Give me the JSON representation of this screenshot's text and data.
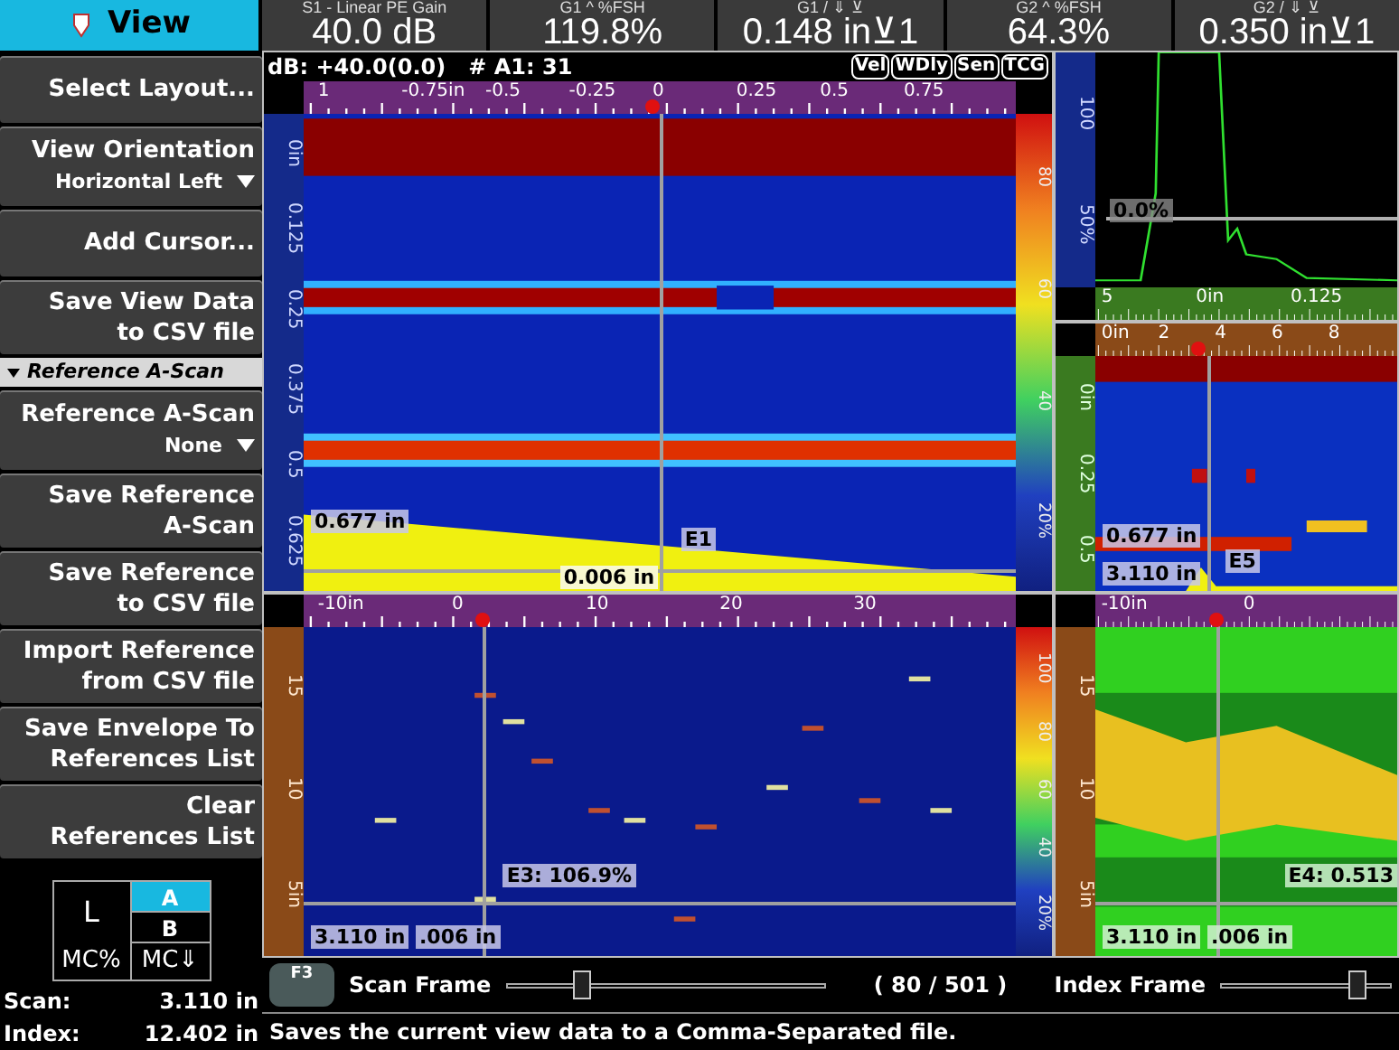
{
  "top_bar": {
    "view_tab": {
      "label": "View",
      "selected": true
    },
    "readouts": [
      {
        "label": "S1 - Linear PE Gain",
        "value": "40.0 dB"
      },
      {
        "label": "G1 ^ %FSH",
        "value": "119.8%"
      },
      {
        "label": "G1 / ⇓ ⊻",
        "value": "0.148 in⊻1"
      },
      {
        "label": "G2 ^ %FSH",
        "value": "64.3%"
      },
      {
        "label": "G2 / ⇓ ⊻",
        "value": "0.350 in⊻1"
      }
    ]
  },
  "sidebar": {
    "items": [
      {
        "kind": "button",
        "lines": [
          "Select Layout..."
        ]
      },
      {
        "kind": "dropdown",
        "lines": [
          "View Orientation"
        ],
        "value": "Horizontal Left"
      },
      {
        "kind": "button",
        "lines": [
          "Add Cursor..."
        ]
      },
      {
        "kind": "button",
        "lines": [
          "Save View Data",
          "to CSV file"
        ]
      },
      {
        "kind": "section",
        "lines": [
          "Reference A-Scan"
        ],
        "expanded": true
      },
      {
        "kind": "dropdown",
        "lines": [
          "Reference A-Scan"
        ],
        "value": "None"
      },
      {
        "kind": "button",
        "lines": [
          "Save Reference",
          "A-Scan"
        ]
      },
      {
        "kind": "button",
        "lines": [
          "Save Reference",
          "to CSV file"
        ]
      },
      {
        "kind": "button",
        "lines": [
          "Import Reference",
          "from CSV file"
        ]
      },
      {
        "kind": "button",
        "lines": [
          "Save Envelope To",
          "References List"
        ]
      },
      {
        "kind": "button",
        "lines": [
          "Clear",
          "References List"
        ]
      }
    ],
    "group_selector": {
      "left_label": "L",
      "tabs": [
        {
          "label": "A",
          "selected": true
        },
        {
          "label": "B",
          "selected": false
        }
      ],
      "bottom": [
        "MC%",
        "MC⇓"
      ]
    },
    "readings": [
      {
        "label": "Scan:",
        "value": "3.110 in"
      },
      {
        "label": "Index:",
        "value": "12.402 in"
      }
    ]
  },
  "panels": [
    {
      "kind": "bscan",
      "header": {
        "text": "dB: +40.0(0.0)   # A1: 31",
        "badges": [
          "Vel",
          "WDly",
          "Sen",
          "TCG"
        ]
      },
      "h_ruler": [
        "1",
        "-0.75in",
        "-0.5",
        "-0.25",
        "0",
        "0.25",
        "0.5",
        "0.75"
      ],
      "v_ruler": [
        "0in",
        "0.125",
        "0.25",
        "0.375",
        "0.5",
        "0.625"
      ],
      "color_scale": [
        "80",
        "60",
        "40",
        "20%"
      ],
      "tags": [
        "0.677 in",
        "E1",
        "0.006 in"
      ]
    },
    {
      "kind": "ascan",
      "h_ruler": [
        "5",
        "0in",
        "0.125"
      ],
      "v_ruler": [
        "100",
        "50%"
      ],
      "tags": [
        "0.0%"
      ]
    },
    {
      "kind": "sscan",
      "h_ruler": [
        "0in",
        "2",
        "4",
        "6",
        "8"
      ],
      "v_ruler": [
        "0in",
        "0.25",
        "0.5"
      ],
      "tags": [
        "0.677 in",
        "3.110 in",
        "E5"
      ]
    },
    {
      "kind": "cscan_amp",
      "h_ruler": [
        "-10in",
        "0",
        "10",
        "20",
        "30"
      ],
      "v_ruler": [
        "15",
        "10",
        "5in"
      ],
      "color_scale": [
        "100",
        "80",
        "60",
        "40",
        "20%"
      ],
      "tags": [
        "E3: 106.9%",
        "3.110 in",
        ".006 in"
      ]
    },
    {
      "kind": "cscan_thick",
      "h_ruler": [
        "-10in",
        "0"
      ],
      "v_ruler": [
        "15",
        "10",
        "5in"
      ],
      "tags": [
        "E4: 0.513",
        "3.110 in",
        ".006 in"
      ]
    }
  ],
  "frame_bar": {
    "key": "F3",
    "scan": {
      "label": "Scan Frame",
      "level": 0.24
    },
    "count": "( 80 / 501 )",
    "index": {
      "label": "Index Frame",
      "level": 0.8
    }
  },
  "status_bar": "Saves the current view data to a Comma-Separated file."
}
